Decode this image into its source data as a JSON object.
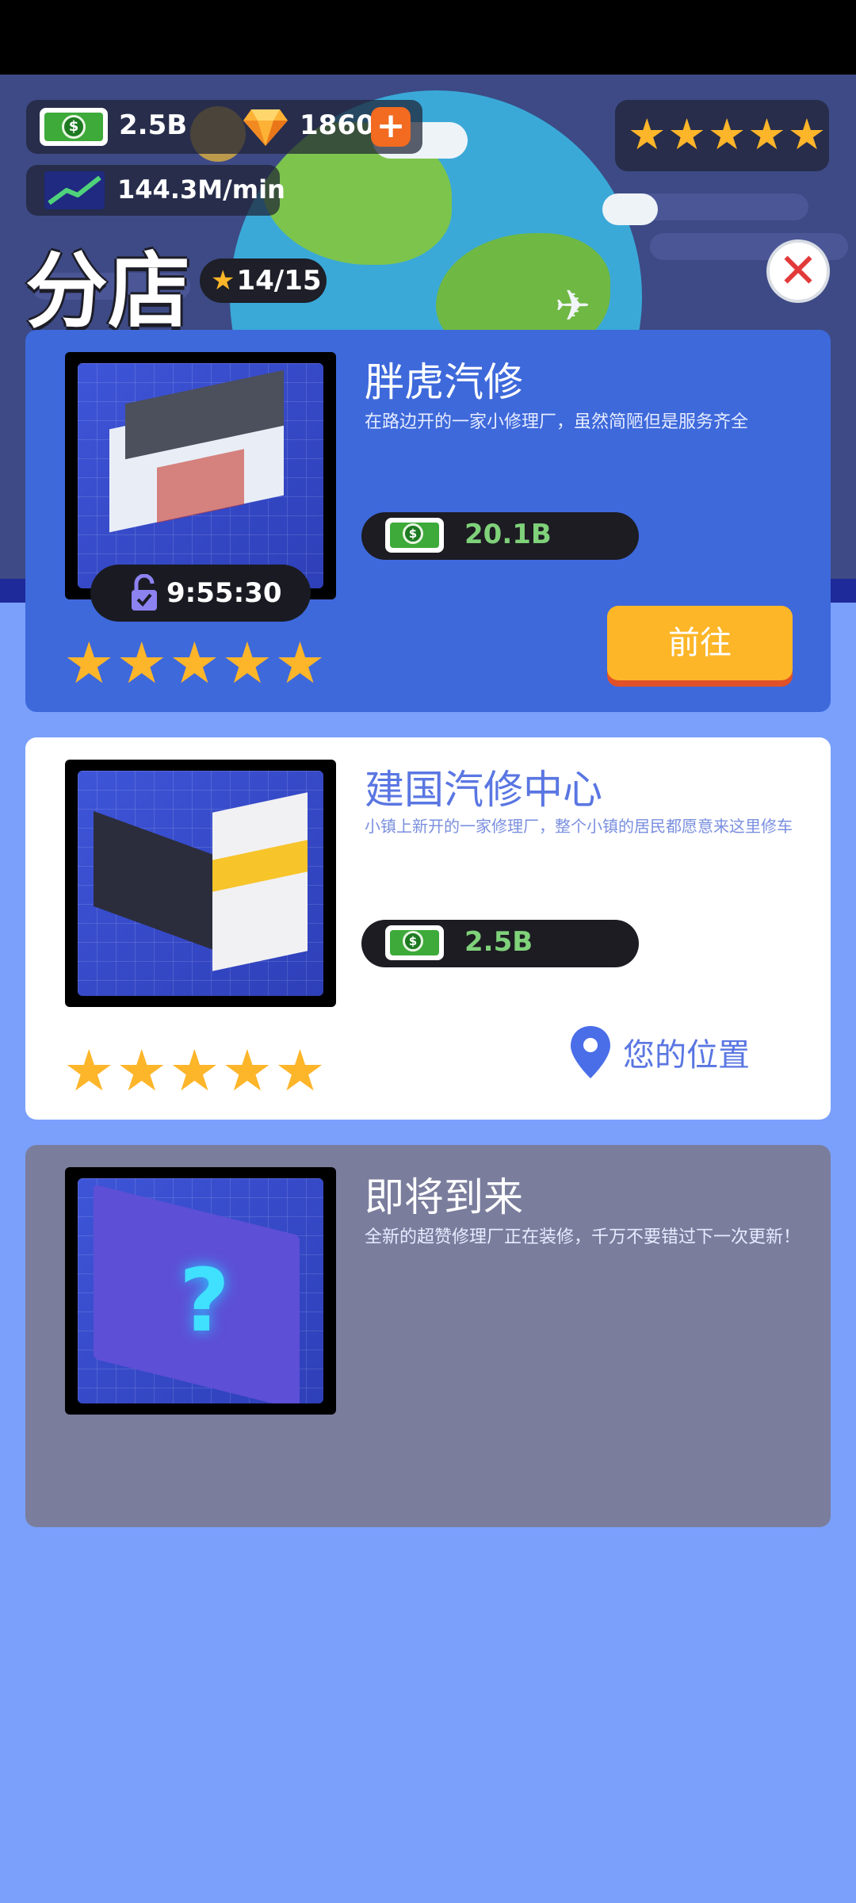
{
  "top_bar": {
    "cash": "2.5B",
    "gems": "1860",
    "plus": "+",
    "income_rate": "144.3M/min",
    "stars": [
      "★",
      "★",
      "★",
      "★",
      "★"
    ]
  },
  "header": {
    "title": "分店",
    "progress": "14/15",
    "close": "✕"
  },
  "branches": [
    {
      "name": "胖虎汽修",
      "description": "在路边开的一家小修理厂，虽然简陋但是服务齐全",
      "price": "20.1B",
      "timer": "9:55:30",
      "stars": [
        "★",
        "★",
        "★",
        "★",
        "★"
      ],
      "action": "前往"
    },
    {
      "name": "建国汽修中心",
      "description": "小镇上新开的一家修理厂，整个小镇的居民都愿意来这里修车",
      "price": "2.5B",
      "stars": [
        "★",
        "★",
        "★",
        "★",
        "★"
      ],
      "location_label": "您的位置"
    },
    {
      "name": "即将到来",
      "description": "全新的超赞修理厂正在装修，千万不要错过下一次更新！",
      "mystery": "?"
    }
  ],
  "colors": {
    "page_bg": "#7aa0fb",
    "active_card": "#3e69db",
    "current_card": "#ffffff",
    "locked_card": "#7b7d9d",
    "star": "#fdb52a",
    "price_text": "#7fd17a",
    "go_button": "#fdb628"
  },
  "icons": {
    "cash": "cash-bill-icon",
    "gem": "diamond-icon",
    "rate": "trend-chart-icon",
    "lock": "unlock-icon",
    "location": "map-pin-icon"
  }
}
